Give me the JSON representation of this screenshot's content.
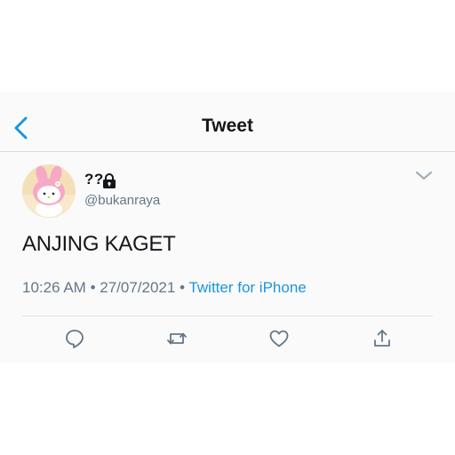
{
  "nav": {
    "title": "Tweet"
  },
  "tweet": {
    "display_name": "??",
    "handle": "@bukanraya",
    "text": "ANJING KAGET",
    "time": "10:26 AM",
    "separator": "•",
    "date": "27/07/2021",
    "source": "Twitter for iPhone"
  },
  "icons": {
    "back": "chevron-left-icon",
    "lock": "lock-icon",
    "caret": "chevron-down-icon",
    "reply": "reply-icon",
    "retweet": "retweet-icon",
    "like": "heart-icon",
    "share": "share-icon"
  },
  "colors": {
    "accent": "#1b95e0",
    "secondary_text": "#657786",
    "icon_gray": "#657786"
  }
}
